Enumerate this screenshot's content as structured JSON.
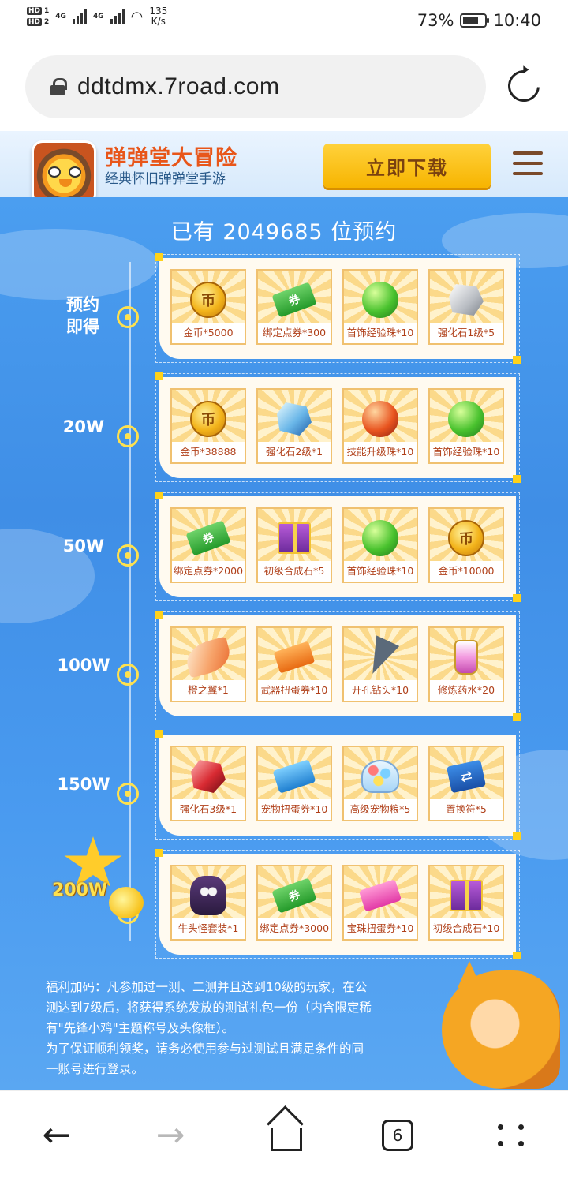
{
  "status_bar": {
    "hd1": "HD",
    "hd1_num": "1",
    "hd2": "HD",
    "hd2_num": "2",
    "net1": "4G",
    "net2": "4G",
    "speed_value": "135",
    "speed_unit": "K/s",
    "battery_percent_text": "73%",
    "battery_level": 0.73,
    "time": "10:40"
  },
  "browser": {
    "url": "ddtdmx.7road.com",
    "tab_count": "6"
  },
  "site_header": {
    "title": "弹弹堂大冒险",
    "subtitle": "经典怀旧弹弹堂手游",
    "download_label": "立即下载"
  },
  "main": {
    "reservation_text": "已有 2049685 位预约",
    "tiers": [
      {
        "label": "预约即得",
        "items": [
          {
            "icon": "gold-coin-icon",
            "name": "金币*5000"
          },
          {
            "icon": "bound-voucher-icon",
            "name": "绑定点券*300"
          },
          {
            "icon": "green-orb-icon",
            "name": "首饰经验珠*10"
          },
          {
            "icon": "white-stone-icon",
            "name": "强化石1级*5"
          }
        ]
      },
      {
        "label": "20W",
        "items": [
          {
            "icon": "gold-coin-icon",
            "name": "金币*38888"
          },
          {
            "icon": "blue-stone-icon",
            "name": "强化石2级*1"
          },
          {
            "icon": "red-orb-icon",
            "name": "技能升级珠*10"
          },
          {
            "icon": "green-orb-icon",
            "name": "首饰经验珠*10"
          }
        ]
      },
      {
        "label": "50W",
        "items": [
          {
            "icon": "bound-voucher-icon",
            "name": "绑定点券*2000"
          },
          {
            "icon": "gift-box-icon",
            "name": "初级合成石*5"
          },
          {
            "icon": "green-orb-icon",
            "name": "首饰经验珠*10"
          },
          {
            "icon": "gold-coin-icon",
            "name": "金币*10000"
          }
        ]
      },
      {
        "label": "100W",
        "items": [
          {
            "icon": "orange-wing-icon",
            "name": "橙之翼*1"
          },
          {
            "icon": "weapon-ticket-icon",
            "name": "武器扭蛋券*10"
          },
          {
            "icon": "drill-icon",
            "name": "开孔钻头*10"
          },
          {
            "icon": "potion-icon",
            "name": "修炼药水*20"
          }
        ]
      },
      {
        "label": "150W",
        "items": [
          {
            "icon": "red-stone-icon",
            "name": "强化石3级*1"
          },
          {
            "icon": "pet-ticket-icon",
            "name": "宠物扭蛋券*10"
          },
          {
            "icon": "candy-jar-icon",
            "name": "高级宠物粮*5"
          },
          {
            "icon": "swap-card-icon",
            "name": "置换符*5"
          }
        ]
      },
      {
        "label": "200W",
        "items": [
          {
            "icon": "bull-monster-icon",
            "name": "牛头怪套装*1"
          },
          {
            "icon": "bound-voucher-icon",
            "name": "绑定点券*3000"
          },
          {
            "icon": "gem-ticket-icon",
            "name": "宝珠扭蛋券*10"
          },
          {
            "icon": "gift-box-icon",
            "name": "初级合成石*10"
          }
        ]
      }
    ],
    "notice_lines": [
      "福利加码：凡参加过一测、二测并且达到10级的玩家，在公",
      "测达到7级后，将获得系统发放的测试礼包一份（内含限定稀",
      "有\"先锋小鸡\"主题称号及头像框）。",
      "为了保证顺利领奖，请务必使用参与过测试且满足条件的同",
      "一账号进行登录。"
    ]
  }
}
